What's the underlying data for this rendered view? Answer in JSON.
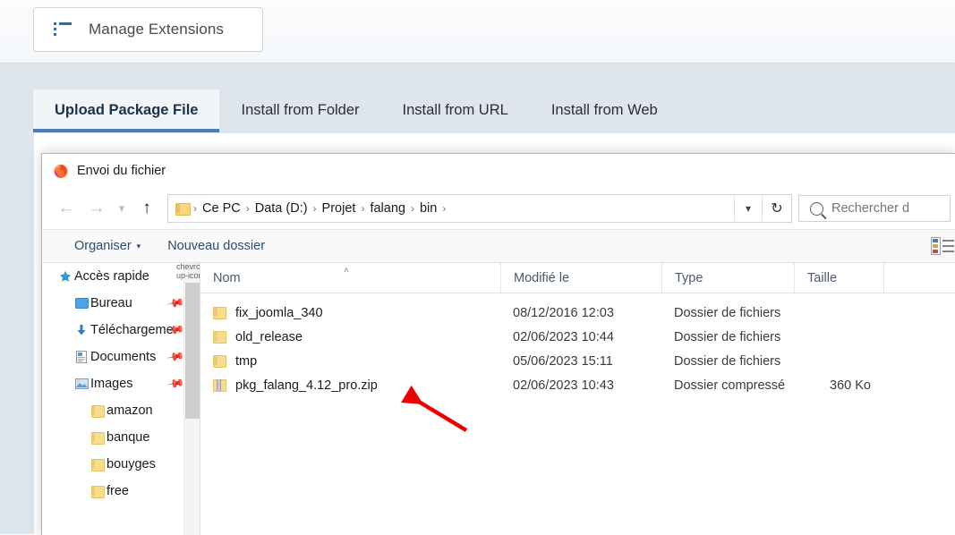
{
  "joomla": {
    "toolbar": {
      "manage_extensions_label": "Manage Extensions",
      "list_icon": "list-icon"
    },
    "tabs": [
      {
        "label": "Upload Package File",
        "active": true
      },
      {
        "label": "Install from Folder",
        "active": false
      },
      {
        "label": "Install from URL",
        "active": false
      },
      {
        "label": "Install from Web",
        "active": false
      }
    ]
  },
  "dialog": {
    "title": "Envoi du fichier",
    "app_icon": "firefox-icon",
    "nav": {
      "back_icon": "arrow-left-icon",
      "forward_icon": "arrow-right-icon",
      "history_icon": "chevron-down-icon",
      "up_icon": "arrow-up-icon",
      "refresh_icon": "refresh-icon",
      "address_dropdown_icon": "chevron-down-icon"
    },
    "breadcrumbs": [
      "Ce PC",
      "Data (D:)",
      "Projet",
      "falang",
      "bin"
    ],
    "breadcrumb_separator": "›",
    "search": {
      "placeholder": "Rechercher d",
      "icon": "search-icon"
    },
    "commands": {
      "organize_label": "Organiser",
      "organize_caret": "▾",
      "new_folder_label": "Nouveau dossier",
      "view_icon": "details-view-icon"
    },
    "nav_pane": {
      "items": [
        {
          "label": "Accès rapide",
          "icon": "star-icon",
          "level": 0,
          "pinned": false
        },
        {
          "label": "Bureau",
          "icon": "desktop-icon",
          "level": 1,
          "pinned": true
        },
        {
          "label": "Téléchargeme",
          "icon": "download-icon",
          "level": 1,
          "pinned": true
        },
        {
          "label": "Documents",
          "icon": "document-icon",
          "level": 1,
          "pinned": true
        },
        {
          "label": "Images",
          "icon": "picture-icon",
          "level": 1,
          "pinned": true
        },
        {
          "label": "amazon",
          "icon": "folder-icon",
          "level": 2,
          "pinned": false
        },
        {
          "label": "banque",
          "icon": "folder-icon",
          "level": 2,
          "pinned": false
        },
        {
          "label": "bouyges",
          "icon": "folder-icon",
          "level": 2,
          "pinned": false
        },
        {
          "label": "free",
          "icon": "folder-icon",
          "level": 2,
          "pinned": false
        }
      ],
      "scroll_up_icon": "chevron-up-icon"
    },
    "columns": {
      "name": "Nom",
      "modified": "Modifié le",
      "type": "Type",
      "size": "Taille",
      "sort_indicator": "˄"
    },
    "files": [
      {
        "name": "fix_joomla_340",
        "modified": "08/12/2016 12:03",
        "type": "Dossier de fichiers",
        "size": "",
        "icon": "folder-icon"
      },
      {
        "name": "old_release",
        "modified": "02/06/2023 10:44",
        "type": "Dossier de fichiers",
        "size": "",
        "icon": "folder-icon"
      },
      {
        "name": "tmp",
        "modified": "05/06/2023 15:11",
        "type": "Dossier de fichiers",
        "size": "",
        "icon": "folder-icon"
      },
      {
        "name": "pkg_falang_4.12_pro.zip",
        "modified": "02/06/2023 10:43",
        "type": "Dossier compressé",
        "size": "360 Ko",
        "icon": "zip-icon"
      }
    ]
  },
  "annotation": {
    "arrow_color": "#ee0000",
    "arrow_name": "red-pointer-arrow"
  },
  "colors": {
    "accent": "#4a7cb5",
    "page_background": "#dfe5ec",
    "tab_active_text": "#19334d",
    "link": "#2b4b72"
  }
}
